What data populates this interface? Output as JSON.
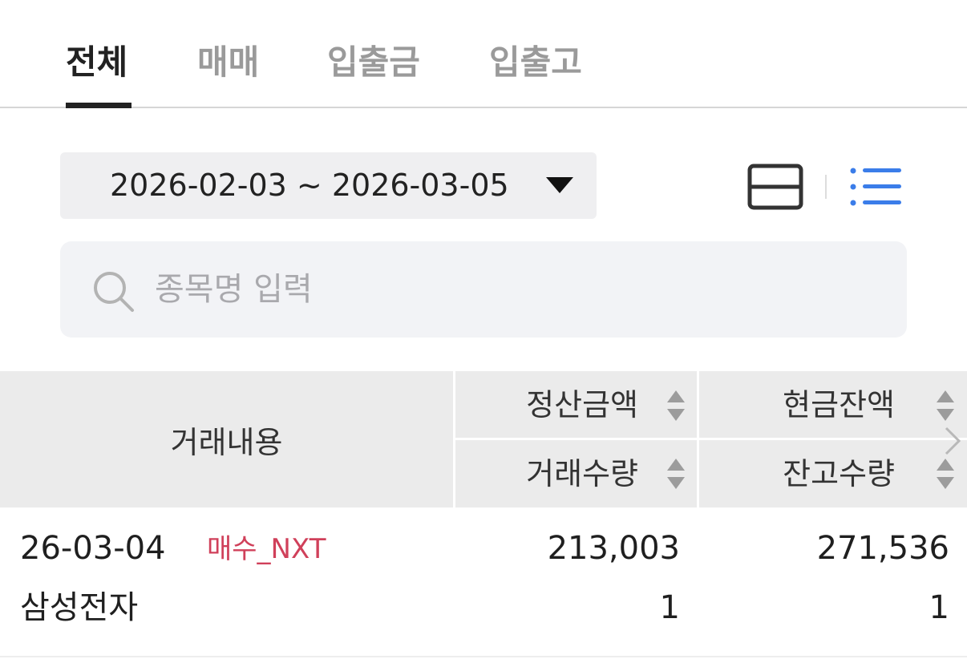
{
  "tabs": [
    {
      "label": "전체",
      "active": true
    },
    {
      "label": "매매",
      "active": false
    },
    {
      "label": "입출금",
      "active": false
    },
    {
      "label": "입출고",
      "active": false
    }
  ],
  "filter": {
    "date_range": "2026-02-03 ~ 2026-03-05"
  },
  "search": {
    "placeholder": "종목명 입력",
    "value": ""
  },
  "table": {
    "headers": {
      "description": "거래내용",
      "settlement_amount": "정산금액",
      "cash_balance": "현금잔액",
      "trade_quantity": "거래수량",
      "balance_quantity": "잔고수량"
    },
    "rows": [
      {
        "date": "26-03-04",
        "trade_type": "매수_NXT",
        "stock_name": "삼성전자",
        "settlement_amount": "213,003",
        "cash_balance": "271,536",
        "trade_quantity": "1",
        "balance_quantity": "1"
      }
    ]
  },
  "icons": {
    "card_view": "card-view-icon",
    "list_view": "list-view-icon",
    "search": "search-icon",
    "sort": "sort-icon",
    "scroll_right": "chevron-right-icon"
  },
  "colors": {
    "active_tab": "#222222",
    "inactive_tab": "#9a9a9a",
    "accent_blue": "#3b7de9",
    "buy_red": "#d0405a",
    "header_bg": "#ebebeb"
  }
}
